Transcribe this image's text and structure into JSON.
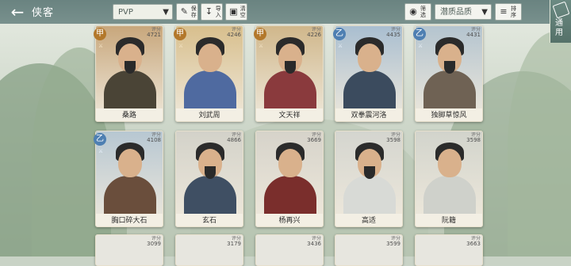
{
  "header": {
    "title": "侠客",
    "filter_select": "PVP",
    "btn_preset": "保存",
    "btn_import": "导入",
    "btn_clear": "清空",
    "btn_filter": "筛选",
    "quality_select": "潜质品质",
    "btn_sort": "排序",
    "side_btn": "通用"
  },
  "colors": {
    "jia": "#b3782b",
    "yi": "#4e7fb2",
    "topbar": "#6a8582"
  },
  "cards": [
    {
      "name": "桑路",
      "rank": "甲",
      "score_label": "评分",
      "score": "4721",
      "tint": "#c8a77c",
      "body": "#4a4436",
      "icon": "sword-icon"
    },
    {
      "name": "刘武周",
      "rank": "甲",
      "score_label": "评分",
      "score": "4246",
      "tint": "#d8bf8d",
      "body": "#4f6aa0",
      "icon": "sword-icon"
    },
    {
      "name": "文天祥",
      "rank": "甲",
      "score_label": "评分",
      "score": "4226",
      "tint": "#d0b78b",
      "body": "#8a3a3d",
      "icon": "swirl-icon"
    },
    {
      "name": "双拳震河洛",
      "rank": "乙",
      "score_label": "评分",
      "score": "4435",
      "tint": "#a9bed0",
      "body": "#3b4b5e",
      "icon": "swirl-icon"
    },
    {
      "name": "独脚草惊风",
      "rank": "乙",
      "score_label": "评分",
      "score": "4431",
      "tint": "#b4c4cf",
      "body": "#6f6254",
      "icon": "leaf-icon"
    },
    {
      "name": "胸口碎大石",
      "rank": "乙",
      "score_label": "评分",
      "score": "4108",
      "tint": "#b7c7d2",
      "body": "#6a4e3c",
      "icon": "shield-icon"
    },
    {
      "name": "玄石",
      "rank": "",
      "score_label": "评分",
      "score": "4866",
      "tint": "#d3d2c9",
      "body": "#3f4f63",
      "icon": ""
    },
    {
      "name": "杨再兴",
      "rank": "",
      "score_label": "评分",
      "score": "3669",
      "tint": "#d6d3ca",
      "body": "#7a2e2c",
      "icon": ""
    },
    {
      "name": "高适",
      "rank": "",
      "score_label": "评分",
      "score": "3598",
      "tint": "#d4d5cf",
      "body": "#d8dad6",
      "icon": ""
    },
    {
      "name": "阮籍",
      "rank": "",
      "score_label": "评分",
      "score": "3598",
      "tint": "#d2d4cc",
      "body": "#cfd1cb",
      "icon": ""
    }
  ],
  "bottom_cards": [
    {
      "score_label": "评分",
      "score": "3099"
    },
    {
      "score_label": "评分",
      "score": "3179"
    },
    {
      "score_label": "评分",
      "score": "3436"
    },
    {
      "score_label": "评分",
      "score": "3599"
    },
    {
      "score_label": "评分",
      "score": "3663"
    }
  ]
}
